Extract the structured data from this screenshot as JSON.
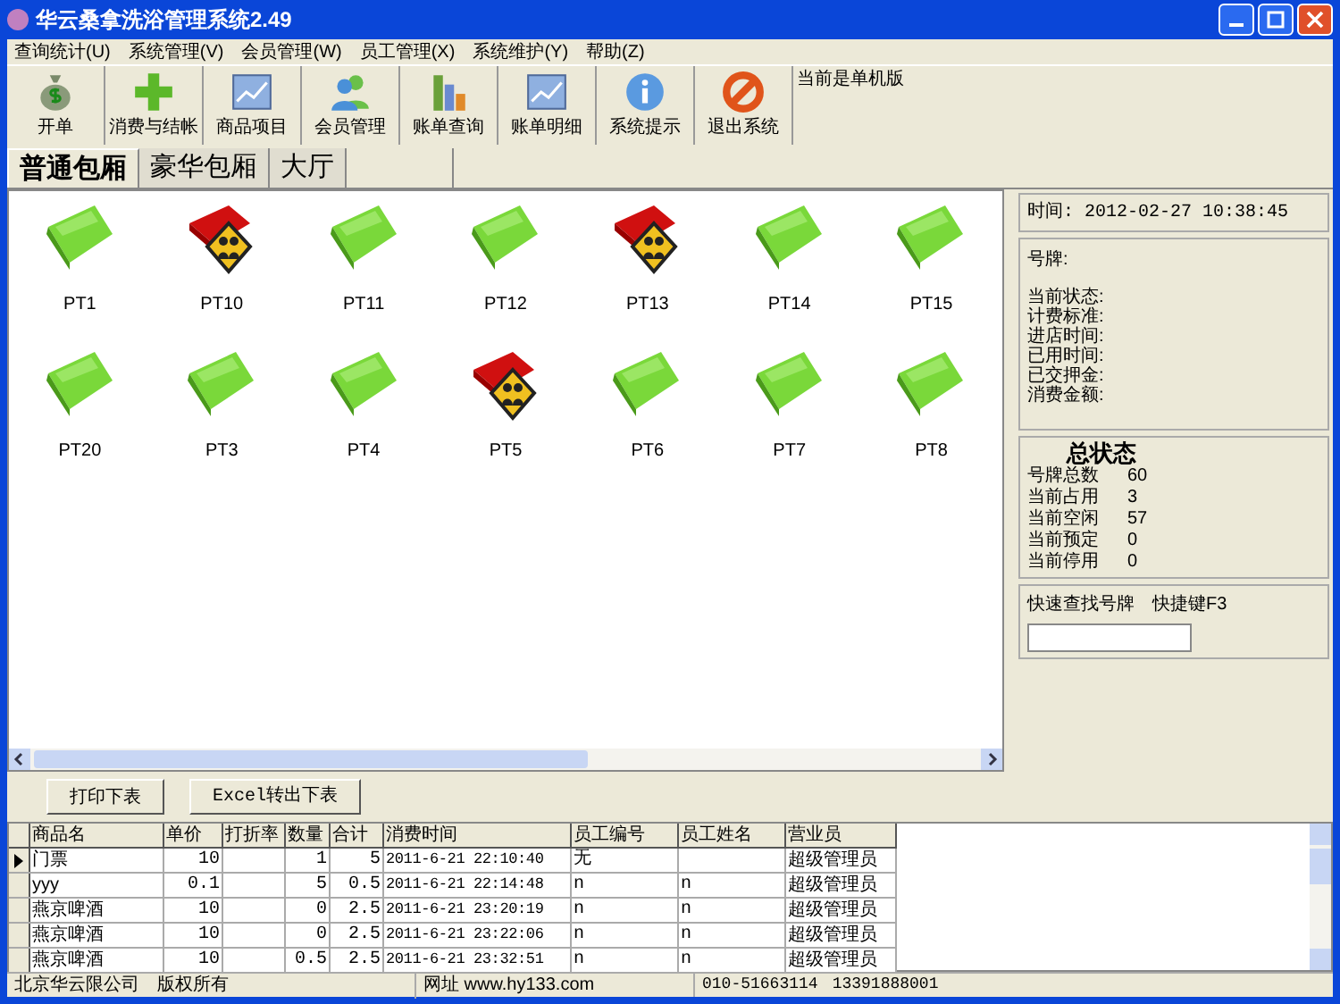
{
  "window": {
    "title": "华云桑拿洗浴管理系统2.49"
  },
  "menu": [
    "查询统计(U)",
    "系统管理(V)",
    "会员管理(W)",
    "员工管理(X)",
    "系统维护(Y)",
    "帮助(Z)"
  ],
  "toolbar": [
    "开单",
    "消费与结帐",
    "商品项目",
    "会员管理",
    "账单查询",
    "账单明细",
    "系统提示",
    "退出系统"
  ],
  "mode_label": "当前是单机版",
  "tabs": [
    {
      "label": "普通包厢",
      "selected": true
    },
    {
      "label": "豪华包厢",
      "selected": false
    },
    {
      "label": "大厅",
      "selected": false
    }
  ],
  "rooms": [
    {
      "name": "PT1",
      "occupied": false
    },
    {
      "name": "PT10",
      "occupied": true
    },
    {
      "name": "PT11",
      "occupied": false
    },
    {
      "name": "PT12",
      "occupied": false
    },
    {
      "name": "PT13",
      "occupied": true
    },
    {
      "name": "PT14",
      "occupied": false
    },
    {
      "name": "PT15",
      "occupied": false
    },
    {
      "name": "PT20",
      "occupied": false
    },
    {
      "name": "PT3",
      "occupied": false
    },
    {
      "name": "PT4",
      "occupied": false
    },
    {
      "name": "PT5",
      "occupied": true
    },
    {
      "name": "PT6",
      "occupied": false
    },
    {
      "name": "PT7",
      "occupied": false
    },
    {
      "name": "PT8",
      "occupied": false
    }
  ],
  "clock": "时间: 2012-02-27 10:38:45",
  "room_info": {
    "title": "号牌:",
    "fields": [
      "当前状态:",
      "计费标准:",
      "进店时间:",
      "已用时间:",
      "已交押金:",
      "消费金额:"
    ]
  },
  "summary": {
    "title": "总状态",
    "rows": [
      {
        "label": "号牌总数",
        "value": "60"
      },
      {
        "label": "当前占用",
        "value": "3"
      },
      {
        "label": "当前空闲",
        "value": "57"
      },
      {
        "label": "当前预定",
        "value": "0"
      },
      {
        "label": "当前停用",
        "value": "0"
      }
    ]
  },
  "quick_find": {
    "label": "快速查找号牌",
    "shortcut": "快捷键F3"
  },
  "actions": [
    "打印下表",
    "Excel转出下表"
  ],
  "table": {
    "columns": [
      "商品名",
      "单价",
      "打折率",
      "数量",
      "合计",
      "消费时间",
      "员工编号",
      "员工姓名",
      "营业员"
    ],
    "rows": [
      {
        "selected": true,
        "cells": [
          "门票",
          "10",
          "",
          "1",
          "5",
          "2011-6-21 22:10:40",
          "无",
          "",
          "超级管理员"
        ]
      },
      {
        "selected": false,
        "cells": [
          "yyy",
          "0.1",
          "",
          "5",
          "0.5",
          "2011-6-21 22:14:48",
          "n",
          "n",
          "超级管理员"
        ]
      },
      {
        "selected": false,
        "cells": [
          "燕京啤酒",
          "10",
          "",
          "0",
          "2.5",
          "2011-6-21 23:20:19",
          "n",
          "n",
          "超级管理员"
        ]
      },
      {
        "selected": false,
        "cells": [
          "燕京啤酒",
          "10",
          "",
          "0",
          "2.5",
          "2011-6-21 23:22:06",
          "n",
          "n",
          "超级管理员"
        ]
      },
      {
        "selected": false,
        "cells": [
          "燕京啤酒",
          "10",
          "",
          "0.5",
          "2.5",
          "2011-6-21 23:32:51",
          "n",
          "n",
          "超级管理员"
        ]
      }
    ]
  },
  "status_bar": [
    "北京华云限公司",
    "版权所有",
    "网址 www.hy133.com",
    "010-51663114",
    "13391888001"
  ]
}
